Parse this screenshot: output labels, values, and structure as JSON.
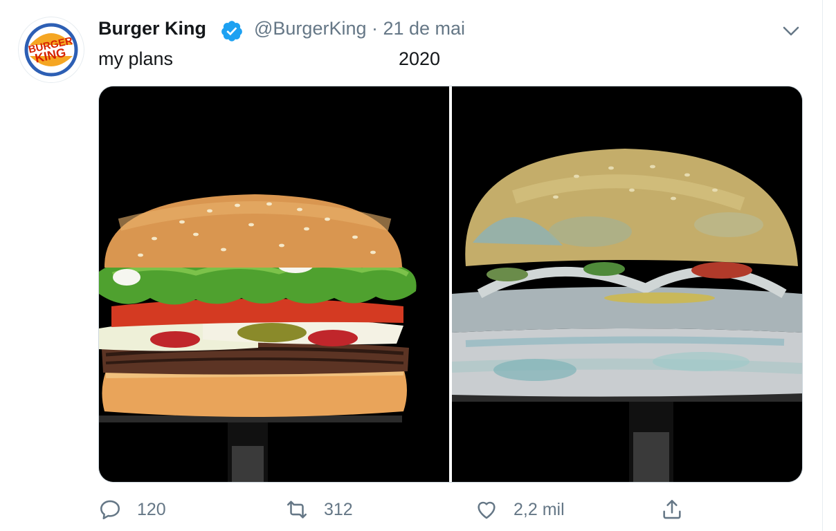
{
  "tweet": {
    "author_name": "Burger King",
    "handle_and_date": "@BurgerKing · 21 de mai",
    "text_left": "my plans",
    "text_right": "2020",
    "logo_text": [
      "BURGER",
      "KING"
    ]
  },
  "media": {
    "left_image": "fresh-burger",
    "right_image": "moldy-burger"
  },
  "actions": {
    "replies": "120",
    "retweets": "312",
    "likes": "2,2 mil"
  },
  "icons": {
    "verified": "verified-badge-icon",
    "menu": "chevron-down-icon",
    "reply": "reply-icon",
    "retweet": "retweet-icon",
    "like": "heart-icon",
    "share": "share-icon"
  },
  "colors": {
    "verified_blue": "#1da1f2",
    "secondary_text": "#657786",
    "bk_red": "#d62300",
    "bk_orange": "#f5a623",
    "bk_blue": "#2d5fb4"
  }
}
